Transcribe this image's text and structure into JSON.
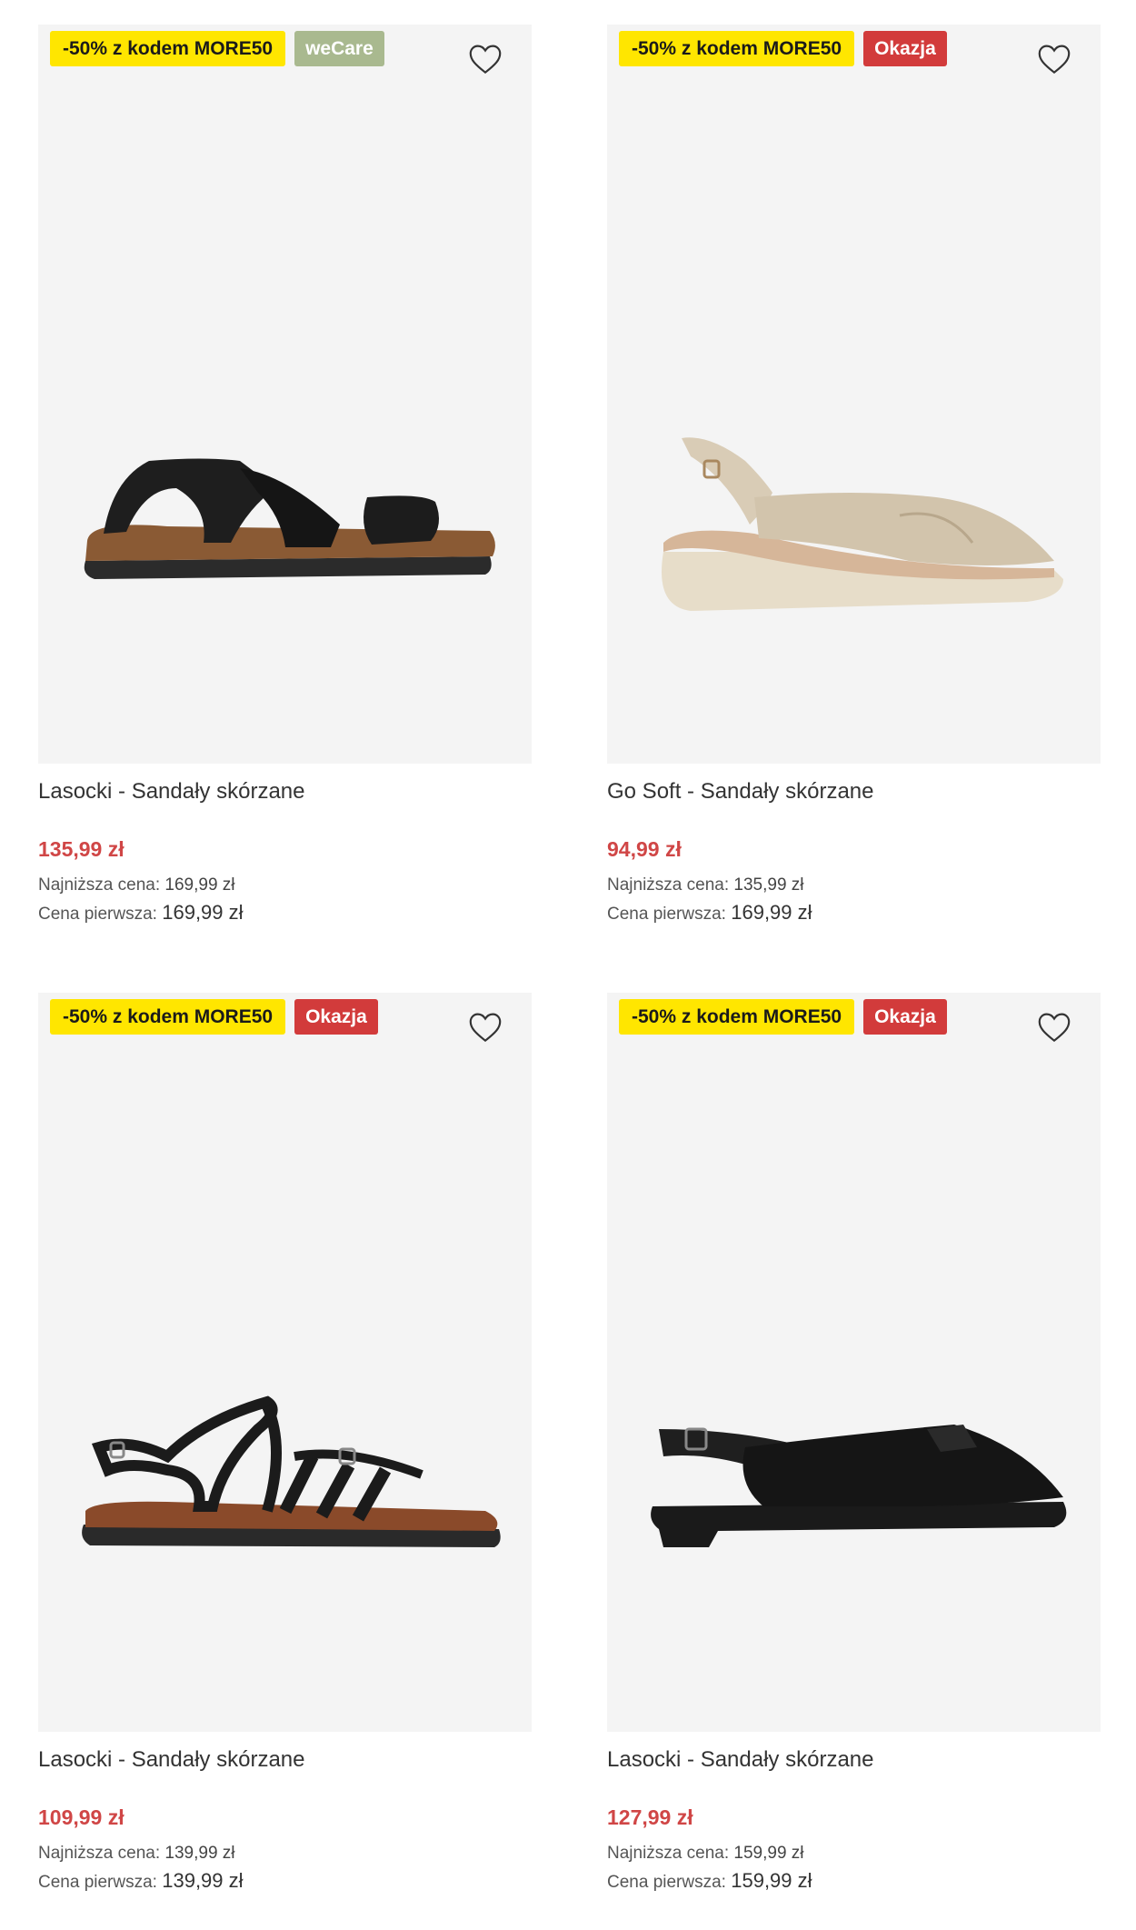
{
  "products": [
    {
      "brand_title": "Lasocki - Sandały skórzane",
      "promo_badge": "-50% z kodem MORE50",
      "tag_badge": "weCare",
      "price": "135,99 zł",
      "lowest_label": "Najniższa cena:",
      "lowest_price": "169,99 zł",
      "first_label": "Cena pierwsza:",
      "first_price": "169,99 zł"
    },
    {
      "brand_title": "Go Soft - Sandały skórzane",
      "promo_badge": "-50% z kodem MORE50",
      "tag_badge": "Okazja",
      "price": "94,99 zł",
      "lowest_label": "Najniższa cena:",
      "lowest_price": "135,99 zł",
      "first_label": "Cena pierwsza:",
      "first_price": "169,99 zł"
    },
    {
      "brand_title": "Lasocki - Sandały skórzane",
      "promo_badge": "-50% z kodem MORE50",
      "tag_badge": "Okazja",
      "price": "109,99 zł",
      "lowest_label": "Najniższa cena:",
      "lowest_price": "139,99 zł",
      "first_label": "Cena pierwsza:",
      "first_price": "139,99 zł"
    },
    {
      "brand_title": "Lasocki - Sandały skórzane",
      "promo_badge": "-50% z kodem MORE50",
      "tag_badge": "Okazja",
      "price": "127,99 zł",
      "lowest_label": "Najniższa cena:",
      "lowest_price": "159,99 zł",
      "first_label": "Cena pierwsza:",
      "first_price": "159,99 zł"
    }
  ],
  "colors": {
    "promo_yellow": "#ffe600",
    "wecare_green": "#a9b98f",
    "okazja_red": "#d23b3b",
    "price_red": "#d04646",
    "image_bg": "#f4f4f4"
  }
}
